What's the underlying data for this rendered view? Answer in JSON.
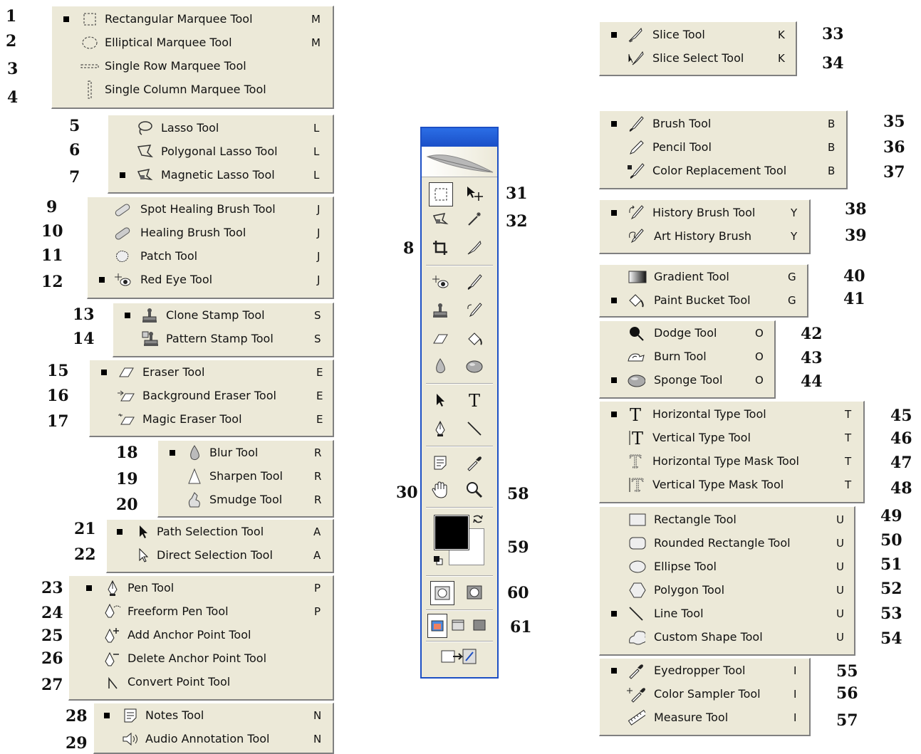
{
  "groups": {
    "marquee": {
      "num": [
        "1",
        "2",
        "3",
        "4"
      ],
      "items": [
        {
          "label": "Rectangular Marquee Tool",
          "key": "M"
        },
        {
          "label": "Elliptical Marquee Tool",
          "key": "M"
        },
        {
          "label": "Single Row Marquee Tool",
          "key": ""
        },
        {
          "label": "Single Column Marquee Tool",
          "key": ""
        }
      ]
    },
    "lasso": {
      "num": [
        "5",
        "6",
        "7"
      ],
      "items": [
        {
          "label": "Lasso Tool",
          "key": "L"
        },
        {
          "label": "Polygonal Lasso Tool",
          "key": "L"
        },
        {
          "label": "Magnetic Lasso Tool",
          "key": "L"
        }
      ]
    },
    "healing": {
      "num": [
        "9",
        "10",
        "11",
        "12"
      ],
      "items": [
        {
          "label": "Spot Healing Brush Tool",
          "key": "J"
        },
        {
          "label": "Healing Brush Tool",
          "key": "J"
        },
        {
          "label": "Patch Tool",
          "key": "J"
        },
        {
          "label": "Red Eye Tool",
          "key": "J"
        }
      ]
    },
    "stamp": {
      "num": [
        "13",
        "14"
      ],
      "items": [
        {
          "label": "Clone Stamp Tool",
          "key": "S"
        },
        {
          "label": "Pattern Stamp Tool",
          "key": "S"
        }
      ]
    },
    "eraser": {
      "num": [
        "15",
        "16",
        "17"
      ],
      "items": [
        {
          "label": "Eraser Tool",
          "key": "E"
        },
        {
          "label": "Background Eraser Tool",
          "key": "E"
        },
        {
          "label": "Magic Eraser Tool",
          "key": "E"
        }
      ]
    },
    "blur": {
      "num": [
        "18",
        "19",
        "20"
      ],
      "items": [
        {
          "label": "Blur Tool",
          "key": "R"
        },
        {
          "label": "Sharpen Tool",
          "key": "R"
        },
        {
          "label": "Smudge Tool",
          "key": "R"
        }
      ]
    },
    "selection": {
      "num": [
        "21",
        "22"
      ],
      "items": [
        {
          "label": "Path Selection Tool",
          "key": "A"
        },
        {
          "label": "Direct Selection Tool",
          "key": "A"
        }
      ]
    },
    "pen": {
      "num": [
        "23",
        "24",
        "25",
        "26",
        "27"
      ],
      "items": [
        {
          "label": "Pen Tool",
          "key": "P"
        },
        {
          "label": "Freeform Pen Tool",
          "key": "P"
        },
        {
          "label": "Add Anchor Point Tool",
          "key": ""
        },
        {
          "label": "Delete Anchor Point Tool",
          "key": ""
        },
        {
          "label": "Convert Point Tool",
          "key": ""
        }
      ]
    },
    "notes": {
      "num": [
        "28",
        "29"
      ],
      "items": [
        {
          "label": "Notes Tool",
          "key": "N"
        },
        {
          "label": "Audio Annotation Tool",
          "key": "N"
        }
      ]
    },
    "slice": {
      "num": [
        "33",
        "34"
      ],
      "items": [
        {
          "label": "Slice Tool",
          "key": "K"
        },
        {
          "label": "Slice Select Tool",
          "key": "K"
        }
      ]
    },
    "brush": {
      "num": [
        "35",
        "36",
        "37"
      ],
      "items": [
        {
          "label": "Brush Tool",
          "key": "B"
        },
        {
          "label": "Pencil Tool",
          "key": "B"
        },
        {
          "label": "Color Replacement Tool",
          "key": "B"
        }
      ]
    },
    "history": {
      "num": [
        "38",
        "39"
      ],
      "items": [
        {
          "label": "History Brush Tool",
          "key": "Y"
        },
        {
          "label": "Art History Brush",
          "key": "Y"
        }
      ]
    },
    "gradient": {
      "num": [
        "40",
        "41"
      ],
      "items": [
        {
          "label": "Gradient Tool",
          "key": "G"
        },
        {
          "label": "Paint Bucket Tool",
          "key": "G"
        }
      ]
    },
    "dodge": {
      "num": [
        "42",
        "43",
        "44"
      ],
      "items": [
        {
          "label": "Dodge Tool",
          "key": "O"
        },
        {
          "label": "Burn Tool",
          "key": "O"
        },
        {
          "label": "Sponge Tool",
          "key": "O"
        }
      ]
    },
    "type": {
      "num": [
        "45",
        "46",
        "47",
        "48"
      ],
      "items": [
        {
          "label": "Horizontal Type Tool",
          "key": "T"
        },
        {
          "label": "Vertical Type Tool",
          "key": "T"
        },
        {
          "label": "Horizontal Type Mask Tool",
          "key": "T"
        },
        {
          "label": "Vertical Type Mask Tool",
          "key": "T"
        }
      ]
    },
    "shape": {
      "num": [
        "49",
        "50",
        "51",
        "52",
        "53",
        "54"
      ],
      "items": [
        {
          "label": "Rectangle Tool",
          "key": "U"
        },
        {
          "label": "Rounded Rectangle Tool",
          "key": "U"
        },
        {
          "label": "Ellipse Tool",
          "key": "U"
        },
        {
          "label": "Polygon Tool",
          "key": "U"
        },
        {
          "label": "Line Tool",
          "key": "U"
        },
        {
          "label": "Custom Shape Tool",
          "key": "U"
        }
      ]
    },
    "eyedropper": {
      "num": [
        "55",
        "56",
        "57"
      ],
      "items": [
        {
          "label": "Eyedropper Tool",
          "key": "I"
        },
        {
          "label": "Color Sampler Tool",
          "key": "I"
        },
        {
          "label": "Measure Tool",
          "key": "I"
        }
      ]
    }
  },
  "toolbox_numbers": {
    "n8": "8",
    "n30": "30",
    "n31": "31",
    "n32": "32",
    "n58": "58",
    "n59": "59",
    "n60": "60",
    "n61": "61"
  },
  "colors": {
    "panel_bg": "#ece9d8",
    "toolbox_border": "#1c4fc4",
    "foreground": "#000000",
    "background": "#ffffff"
  }
}
